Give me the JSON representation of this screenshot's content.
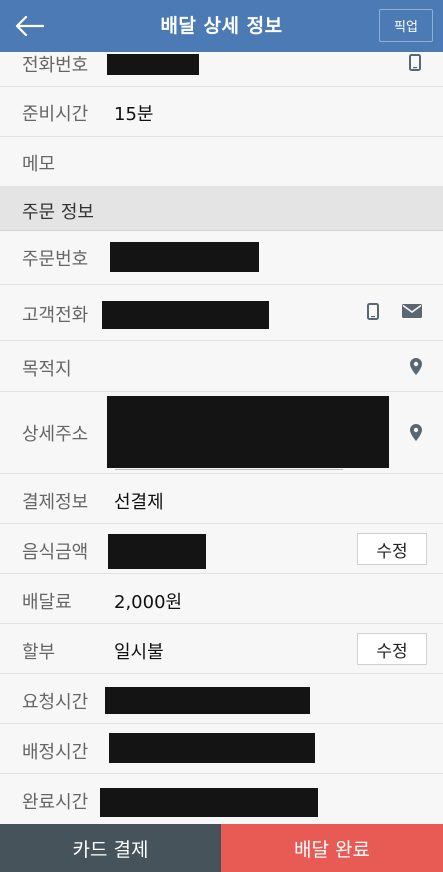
{
  "header": {
    "title": "배달 상세 정보",
    "pickup_label": "픽업"
  },
  "store": {
    "phone_label": "전화번호",
    "prep_time_label": "준비시간",
    "prep_time_value": "15분",
    "memo_label": "메모"
  },
  "order": {
    "section_title": "주문 정보",
    "order_number_label": "주문번호",
    "customer_phone_label": "고객전화",
    "destination_label": "목적지",
    "detail_address_label": "상세주소",
    "payment_label": "결제정보",
    "payment_value": "선결제",
    "food_amount_label": "음식금액",
    "edit_label": "수정",
    "delivery_fee_label": "배달료",
    "delivery_fee_value": "2,000원",
    "installment_label": "할부",
    "installment_value": "일시불",
    "request_time_label": "요청시간",
    "assign_time_label": "배정시간",
    "complete_time_label": "완료시간"
  },
  "footer": {
    "card_payment_label": "카드 결제",
    "delivery_complete_label": "배달 완료"
  },
  "colors": {
    "header_bg": "#4b7ab5",
    "card_button_bg": "#46535a",
    "complete_button_bg": "#e85b55"
  }
}
